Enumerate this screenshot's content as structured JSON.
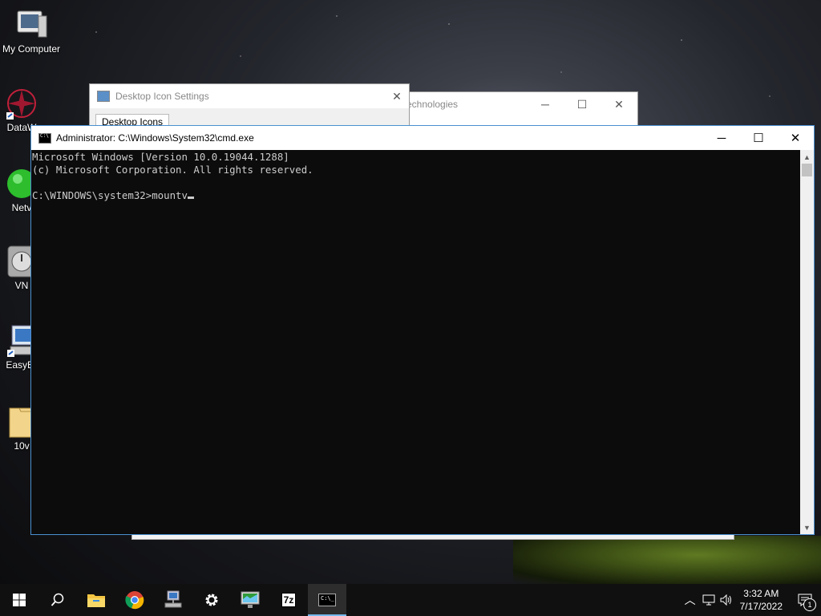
{
  "desktop": {
    "icons": [
      {
        "label": "My Computer",
        "icon": "my-computer-icon"
      },
      {
        "label": "DataW",
        "icon": "datawarehouse-icon"
      },
      {
        "label": "Netv",
        "icon": "network-icon"
      },
      {
        "label": "VN",
        "icon": "vnc-icon"
      },
      {
        "label": "EasyBo",
        "icon": "easybcd-icon"
      },
      {
        "label": "10v",
        "icon": "folder-icon"
      }
    ]
  },
  "bg_windows": {
    "desktop_icon_settings": {
      "title": "Desktop Icon Settings",
      "tab": "Desktop Icons",
      "close": "✕"
    },
    "technologies": {
      "title": "echnologies",
      "minimize": "─",
      "maximize": "☐",
      "close": "✕"
    }
  },
  "cmd": {
    "title": "Administrator: C:\\Windows\\System32\\cmd.exe",
    "minimize": "─",
    "maximize": "☐",
    "close": "✕",
    "lines": [
      "Microsoft Windows [Version 10.0.19044.1288]",
      "(c) Microsoft Corporation. All rights reserved.",
      "",
      "C:\\WINDOWS\\system32>mountv"
    ]
  },
  "taskbar": {
    "items": [
      {
        "name": "start-button",
        "icon": "windows-logo-icon"
      },
      {
        "name": "search-button",
        "icon": "search-icon"
      },
      {
        "name": "file-explorer-button",
        "icon": "folder-icon"
      },
      {
        "name": "chrome-button",
        "icon": "chrome-icon"
      },
      {
        "name": "network-tool-button",
        "icon": "computer-network-icon"
      },
      {
        "name": "settings-button",
        "icon": "gear-icon"
      },
      {
        "name": "remote-desktop-button",
        "icon": "monitor-icon"
      },
      {
        "name": "7zip-button",
        "icon": "7zip-icon"
      },
      {
        "name": "cmd-button",
        "icon": "cmd-icon"
      }
    ],
    "seven_zip_label": "7z",
    "cmd_label": "C:\\_",
    "clock_time": "3:32 AM",
    "clock_date": "7/17/2022",
    "notification_count": "1"
  },
  "colors": {
    "accent": "#76b9ed",
    "console_bg": "#0c0c0c",
    "console_fg": "#cccccc"
  }
}
